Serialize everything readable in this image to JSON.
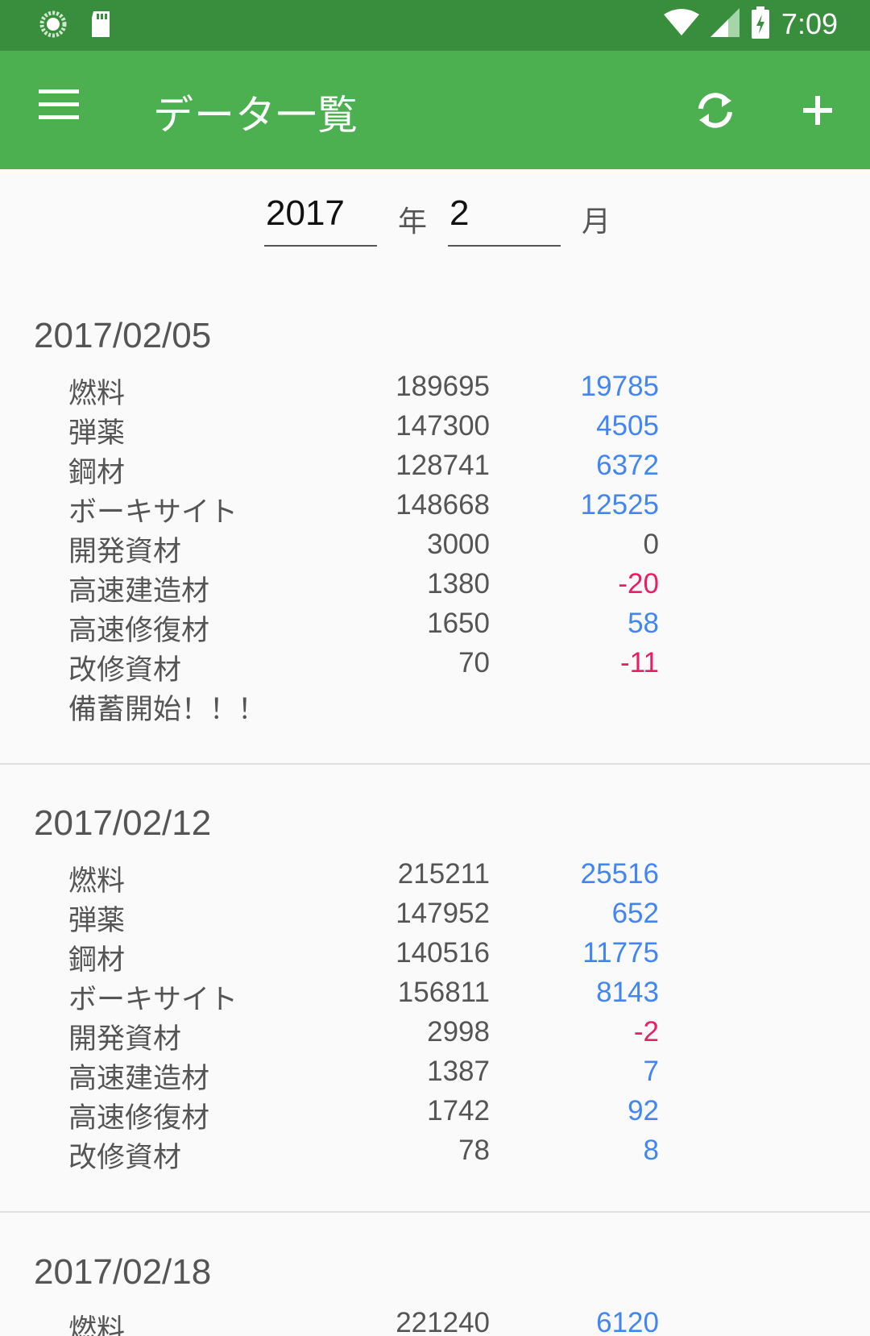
{
  "status_bar": {
    "time": "7:09"
  },
  "toolbar": {
    "title": "データ一覧"
  },
  "date_select": {
    "year": "2017",
    "year_unit": "年",
    "month": "2",
    "month_unit": "月"
  },
  "records": [
    {
      "date": "2017/02/05",
      "rows": [
        {
          "name": "燃料",
          "value": "189695",
          "diff": "19785"
        },
        {
          "name": "弾薬",
          "value": "147300",
          "diff": "4505"
        },
        {
          "name": "鋼材",
          "value": "128741",
          "diff": "6372"
        },
        {
          "name": "ボーキサイト",
          "value": "148668",
          "diff": "12525"
        },
        {
          "name": "開発資材",
          "value": "3000",
          "diff": "0"
        },
        {
          "name": "高速建造材",
          "value": "1380",
          "diff": "-20"
        },
        {
          "name": "高速修復材",
          "value": "1650",
          "diff": "58"
        },
        {
          "name": "改修資材",
          "value": "70",
          "diff": "-11"
        }
      ],
      "note": "備蓄開始！！！"
    },
    {
      "date": "2017/02/12",
      "rows": [
        {
          "name": "燃料",
          "value": "215211",
          "diff": "25516"
        },
        {
          "name": "弾薬",
          "value": "147952",
          "diff": "652"
        },
        {
          "name": "鋼材",
          "value": "140516",
          "diff": "11775"
        },
        {
          "name": "ボーキサイト",
          "value": "156811",
          "diff": "8143"
        },
        {
          "name": "開発資材",
          "value": "2998",
          "diff": "-2"
        },
        {
          "name": "高速建造材",
          "value": "1387",
          "diff": "7"
        },
        {
          "name": "高速修復材",
          "value": "1742",
          "diff": "92"
        },
        {
          "name": "改修資材",
          "value": "78",
          "diff": "8"
        }
      ],
      "note": ""
    },
    {
      "date": "2017/02/18",
      "rows": [
        {
          "name": "燃料",
          "value": "221240",
          "diff": "6120"
        }
      ],
      "note": ""
    }
  ]
}
